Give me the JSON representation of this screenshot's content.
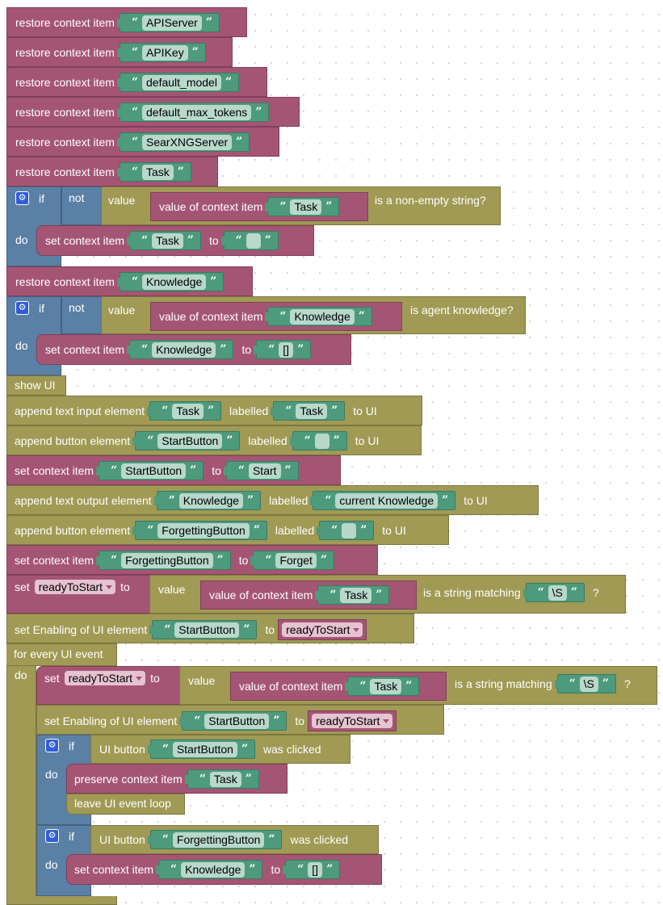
{
  "labels": {
    "restore": "restore context item",
    "set_ctx": "set context item",
    "to": "to",
    "if": "if",
    "do": "do",
    "not": "not",
    "value": "value",
    "value_of_ctx": "value of context item",
    "non_empty": "is a non-empty string?",
    "is_knowledge": "is agent knowledge?",
    "show_ui": "show UI",
    "append_text_input": "append text input element",
    "append_button": "append button element",
    "append_text_output": "append text output element",
    "labelled": "labelled",
    "to_ui": "to UI",
    "set": "set",
    "string_matching": "is a string matching",
    "question": "?",
    "set_enabling": "set Enabling of UI element",
    "for_every": "for every UI event",
    "ui_button": "UI button",
    "was_clicked": "was clicked",
    "preserve": "preserve context item",
    "leave_loop": "leave UI event loop",
    "open_quote": "“",
    "close_quote": "”"
  },
  "restore_items": [
    "APIServer",
    "APIKey",
    "default_model",
    "default_max_tokens",
    "SearXNGServer",
    "Task"
  ],
  "strings": {
    "task": "Task",
    "empty": "",
    "knowledge": "Knowledge",
    "empty_list": "[]",
    "start_button": "StartButton",
    "start": "Start",
    "current_knowledge": "current Knowledge",
    "forgetting_button": "ForgettingButton",
    "forget": "Forget",
    "regex": "\\S"
  },
  "variables": {
    "ready": "readyToStart"
  },
  "colors": {
    "text_block": "#a55574",
    "ui_block": "#a09a55",
    "control_block": "#5b80a5",
    "string_block": "#4d9a7d"
  }
}
